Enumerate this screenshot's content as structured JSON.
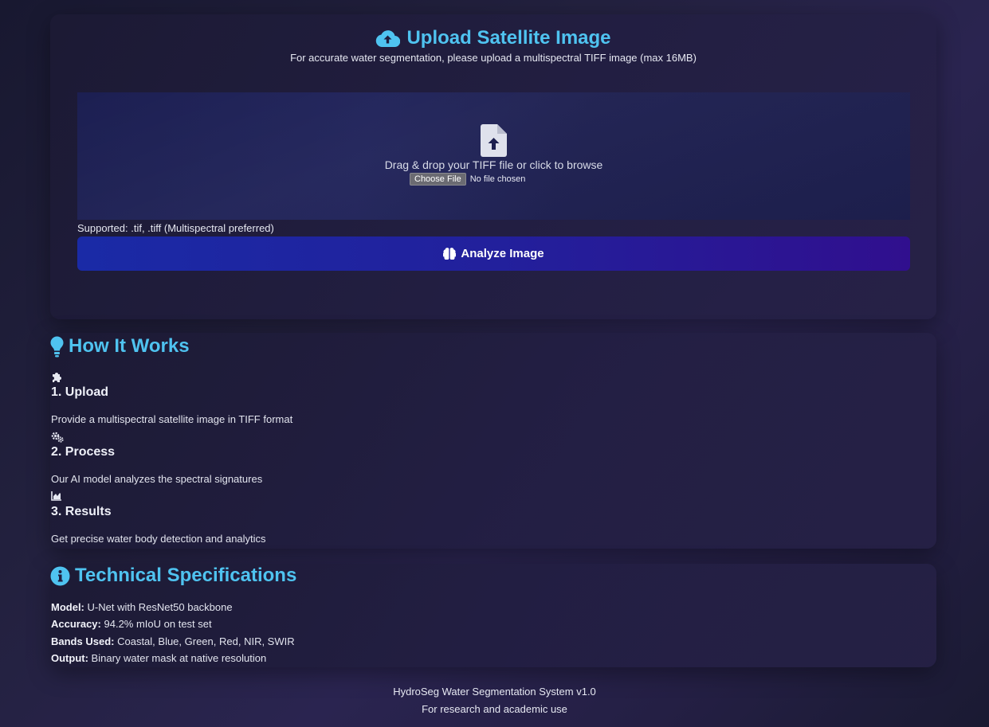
{
  "upload": {
    "title": "Upload Satellite Image",
    "subtitle": "For accurate water segmentation, please upload a multispectral TIFF image (max 16MB)",
    "dropzone_text": "Drag & drop your TIFF file or click to browse",
    "choose_file_label": "Choose File",
    "no_file_text": "No file chosen",
    "supported_text": "Supported: .tif, .tiff (Multispectral preferred)",
    "analyze_label": "Analyze Image"
  },
  "how": {
    "title": "How It Works",
    "steps": [
      {
        "title": "1. Upload",
        "desc": "Provide a multispectral satellite image in TIFF format",
        "icon": "puzzle-icon"
      },
      {
        "title": "2. Process",
        "desc": "Our AI model analyzes the spectral signatures",
        "icon": "cogs-icon"
      },
      {
        "title": "3. Results",
        "desc": "Get precise water body detection and analytics",
        "icon": "chart-area-icon"
      }
    ]
  },
  "specs": {
    "title": "Technical Specifications",
    "items": [
      {
        "label": "Model:",
        "value": "U-Net with ResNet50 backbone"
      },
      {
        "label": "Accuracy:",
        "value": "94.2% mIoU on test set"
      },
      {
        "label": "Bands Used:",
        "value": "Coastal, Blue, Green, Red, NIR, SWIR"
      },
      {
        "label": "Output:",
        "value": "Binary water mask at native resolution"
      }
    ]
  },
  "footer": {
    "line1": "HydroSeg Water Segmentation System v1.0",
    "line2": "For research and academic use"
  },
  "colors": {
    "accent": "#4fc3f0",
    "button_start": "#1a2aa6",
    "button_end": "#300f8e"
  }
}
